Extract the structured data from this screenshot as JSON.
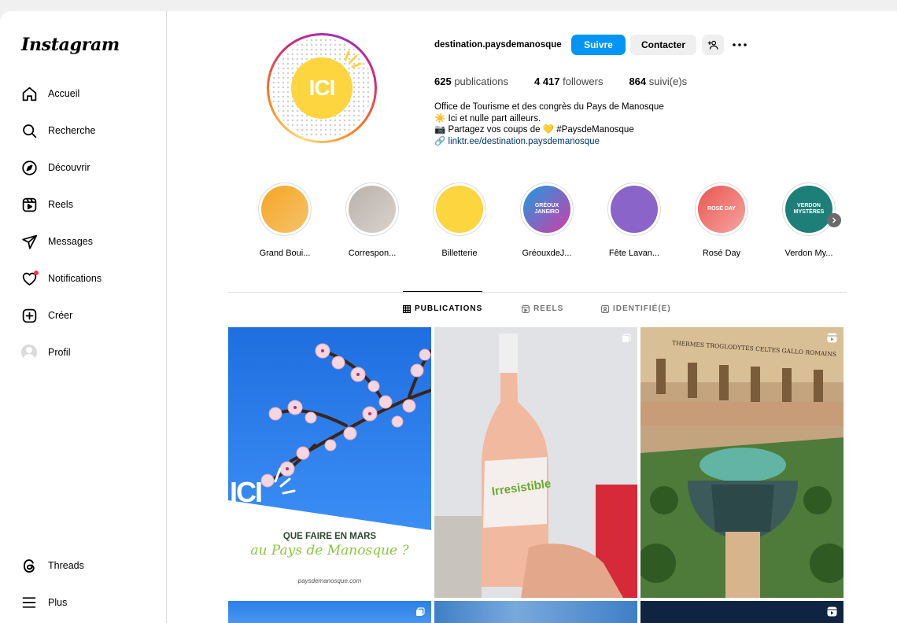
{
  "sidebar": {
    "logo": "Instagram",
    "items": [
      {
        "label": "Accueil",
        "icon": "home-icon"
      },
      {
        "label": "Recherche",
        "icon": "search-icon"
      },
      {
        "label": "Découvrir",
        "icon": "compass-icon"
      },
      {
        "label": "Reels",
        "icon": "reels-icon"
      },
      {
        "label": "Messages",
        "icon": "send-icon"
      },
      {
        "label": "Notifications",
        "icon": "heart-icon"
      },
      {
        "label": "Créer",
        "icon": "plus-square-icon"
      },
      {
        "label": "Profil",
        "icon": "avatar"
      }
    ],
    "bottom": [
      {
        "label": "Threads",
        "icon": "threads-icon"
      },
      {
        "label": "Plus",
        "icon": "menu-icon"
      }
    ]
  },
  "profile": {
    "username": "destination.paysdemanosque",
    "avatar_text": "ICI",
    "follow_label": "Suivre",
    "contact_label": "Contacter",
    "stats": {
      "posts_count": "625",
      "posts_label": "publications",
      "followers_count": "4 417",
      "followers_label": "followers",
      "following_count": "864",
      "following_label": "suivi(e)s"
    },
    "bio": {
      "line1": "Office de Tourisme et des congrès du Pays de Manosque",
      "line2_emoji": "☀️",
      "line2": "Ici et nulle part ailleurs.",
      "line3_emoji": "📷",
      "line3a": "Partagez vos coups de",
      "line3_heart": "💛",
      "line3b": "#PaysdeManosque",
      "link_icon": "🔗",
      "link": "linktr.ee/destination.paysdemanosque"
    }
  },
  "highlights": [
    {
      "label": "Grand Boui...",
      "colors": [
        "#f5a623",
        "#f7c26b"
      ]
    },
    {
      "label": "Correspon...",
      "colors": [
        "#b9b2ad",
        "#d9d3cc"
      ]
    },
    {
      "label": "Billetterie",
      "colors": [
        "#fcd53f",
        "#fcd53f"
      ]
    },
    {
      "label": "GréouxdeJ...",
      "colors": [
        "#1e9be0",
        "#d23ca8"
      ],
      "text": "GRÉOUX JANEIRO"
    },
    {
      "label": "Fête Lavan...",
      "colors": [
        "#8a64c8",
        "#8a64c8"
      ]
    },
    {
      "label": "Rosé Day",
      "colors": [
        "#e8574f",
        "#f6a4a1"
      ],
      "text": "ROSÉ DAY"
    },
    {
      "label": "Verdon My...",
      "colors": [
        "#1d7f78",
        "#1d7f78"
      ],
      "text": "VERDON MYSTÈRES"
    }
  ],
  "tabs": [
    {
      "label": "PUBLICATIONS",
      "icon": "grid-icon",
      "active": true
    },
    {
      "label": "REELS",
      "icon": "reels-icon",
      "active": false
    },
    {
      "label": "IDENTIFIÉ(E)",
      "icon": "tagged-icon",
      "active": false
    }
  ],
  "posts": {
    "p1": {
      "heading": "QUE FAIRE EN MARS",
      "script": "au Pays de Manosque ?",
      "site": "paysdemanosque.com",
      "logo": "ICI"
    },
    "p2": {
      "bottle_label": "Irresistible"
    },
    "p3": {
      "sign": "THERMES  TROGLODYTES  CELTES  GALLO ROMAINS"
    }
  }
}
